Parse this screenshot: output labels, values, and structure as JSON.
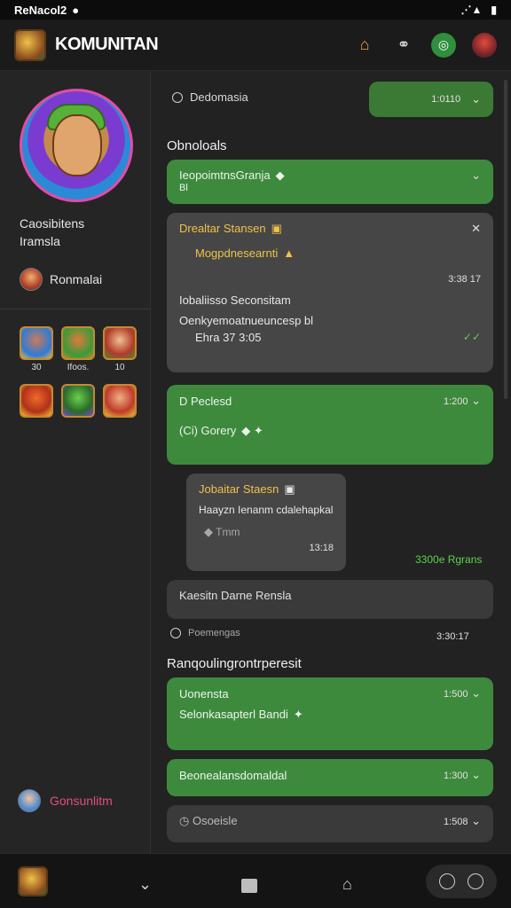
{
  "status": {
    "time": "ReNacol2",
    "signal": "⋰▲",
    "battery": "▮"
  },
  "header": {
    "title": "KOMUNITAN"
  },
  "sidebar": {
    "name_line1": "Caosibitens",
    "name_line2": "Iramsla",
    "link": "Ronmalai",
    "games": [
      {
        "label": "30"
      },
      {
        "label": "Ifoos."
      },
      {
        "label": "10"
      },
      {
        "label": ""
      },
      {
        "label": ""
      },
      {
        "label": ""
      }
    ],
    "bottom_link": "Gonsunlitm"
  },
  "main": {
    "top_label": "Dedomasia",
    "top_pill_time": "1:0110",
    "section1": "Obnoloals",
    "card1_title": "IeopoimtnsGranja",
    "card1_sub": "Bl",
    "card2_title": "Drealtar Stansen",
    "card2_line": "Mogpdnesearnti",
    "card2_time": "3:38 17",
    "card2_item1": "Iobaliisso Seconsitam",
    "card2_item2": "Oenkyemoatnueuncesp bl",
    "card2_item3": "Ehra 37 3:05",
    "card2_check": "✓✓",
    "card3_title": "D Peclesd",
    "card3_time": "1:200",
    "card3_line": "(Ci) Gorery",
    "card4_title": "Jobaitar Staesn",
    "card4_line": "Haayzn Ienanm cdalehapkal",
    "card4_line2": "Tmm",
    "card4_time": "13:18",
    "side_green_note": "3300e Rgrans",
    "card5_line": "Kaesitn   Darne Rensla",
    "small_label": "Poemengas",
    "small_time": "3:30:17",
    "section2": "Ranqoulingrontrperesit",
    "card6_title": "Uonensta",
    "card6_time": "1:500",
    "card6_line": "Selonkasapterl   Bandi",
    "card7_title": "Beonealansdomaldal",
    "card7_time": "1:300",
    "card8_title": "Osoeisle",
    "card8_time": "1:508"
  }
}
